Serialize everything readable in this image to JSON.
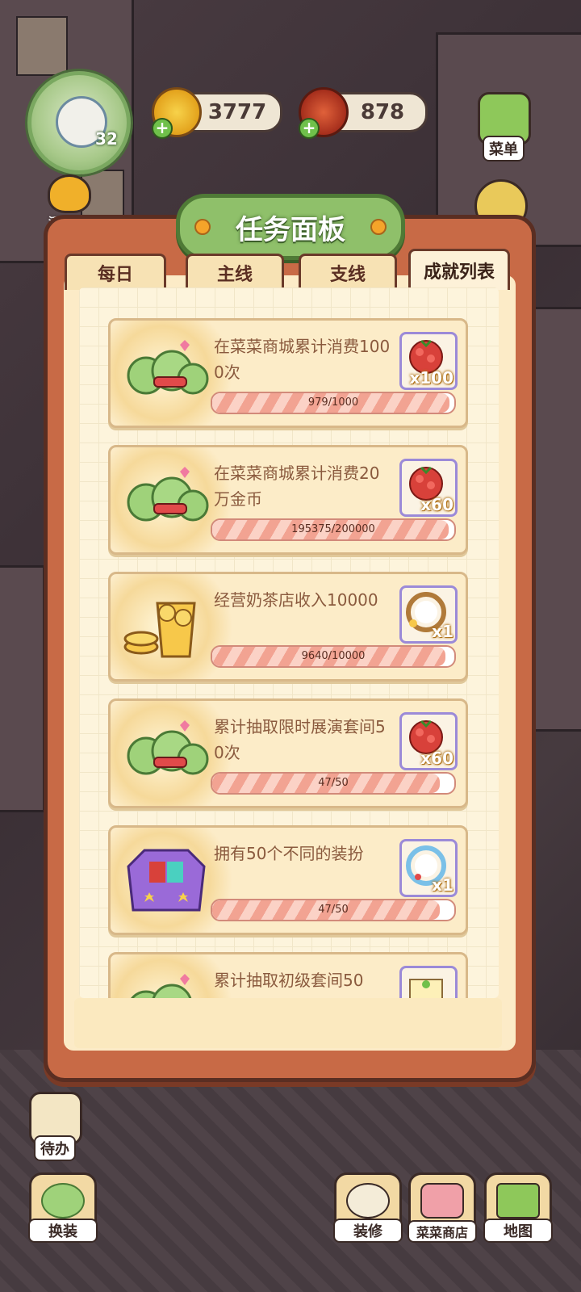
{
  "hud": {
    "level": "32",
    "coins": "3777",
    "food": "878"
  },
  "side": {
    "events_label": "活动汇总",
    "menu_label": "菜单",
    "todo_label": "待办"
  },
  "panel": {
    "title": "任务面板",
    "tabs": [
      {
        "label": "每日",
        "active": false
      },
      {
        "label": "主线",
        "active": false
      },
      {
        "label": "支线",
        "active": false
      },
      {
        "label": "成就列表",
        "active": true
      }
    ]
  },
  "tasks": [
    {
      "text": "在菜菜商城累计消费1000次",
      "progress_text": "979/1000",
      "progress": 0.979,
      "reward_count": "x100",
      "reward_icon": "berry-bundle-icon"
    },
    {
      "text": "在菜菜商城累计消费20万金币",
      "progress_text": "195375/200000",
      "progress": 0.977,
      "reward_count": "x60",
      "reward_icon": "berry-bundle-icon"
    },
    {
      "text": "经营奶茶店收入10000",
      "progress_text": "9640/10000",
      "progress": 0.964,
      "reward_count": "x1",
      "reward_icon": "avatar-frame-icon"
    },
    {
      "text": "累计抽取限时展演套间50次",
      "progress_text": "47/50",
      "progress": 0.94,
      "reward_count": "x60",
      "reward_icon": "berry-bundle-icon"
    },
    {
      "text": "拥有50个不同的装扮",
      "progress_text": "47/50",
      "progress": 0.94,
      "reward_count": "x1",
      "reward_icon": "ribbon-frame-icon"
    },
    {
      "text": "累计抽取初级套间50",
      "progress_text": "",
      "progress": 0,
      "reward_count": "",
      "reward_icon": "ticket-icon"
    }
  ],
  "bottom": {
    "outfit_label": "换装",
    "decor_label": "装修",
    "shop_label": "菜菜商店",
    "map_label": "地图"
  },
  "colors": {
    "panel": "#c86a46",
    "title_green": "#8fc06a",
    "progress": "#f2a392"
  }
}
